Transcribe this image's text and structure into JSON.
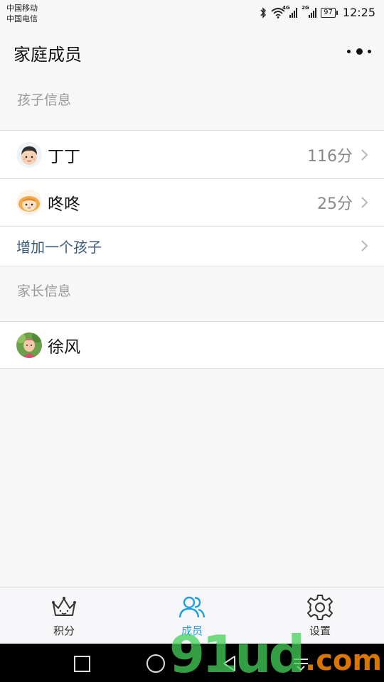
{
  "status_bar": {
    "carrier_1": "中国移动",
    "carrier_2": "中国电信",
    "net_1": "4G",
    "net_2": "2G",
    "battery": "97",
    "time": "12:25"
  },
  "header": {
    "title": "家庭成员"
  },
  "children_section": {
    "label": "孩子信息",
    "items": [
      {
        "name": "丁丁",
        "score": "116分",
        "avatar_icon": "boy-avatar-icon"
      },
      {
        "name": "咚咚",
        "score": "25分",
        "avatar_icon": "girl-avatar-icon"
      }
    ],
    "add_label": "增加一个孩子"
  },
  "parents_section": {
    "label": "家长信息",
    "items": [
      {
        "name": "徐风",
        "avatar_icon": "photo-avatar-icon"
      }
    ]
  },
  "tab_bar": {
    "tabs": [
      {
        "label": "积分",
        "icon": "crown-icon"
      },
      {
        "label": "成员",
        "icon": "members-icon"
      },
      {
        "label": "设置",
        "icon": "gear-icon"
      }
    ],
    "active_index": 1,
    "active_color": "#1ea0e0"
  },
  "watermark": {
    "main": "91ud",
    "suffix": ".com"
  }
}
